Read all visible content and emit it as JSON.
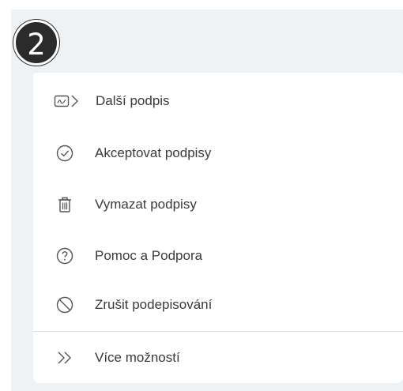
{
  "badge": {
    "number": "2"
  },
  "menu": {
    "items": [
      {
        "label": "Další podpis",
        "icon": "next-signature-icon"
      },
      {
        "label": "Akceptovat podpisy",
        "icon": "check-circle-icon"
      },
      {
        "label": "Vymazat podpisy",
        "icon": "trash-icon"
      },
      {
        "label": "Pomoc a Podpora",
        "icon": "help-circle-icon"
      },
      {
        "label": "Zrušit podepisování",
        "icon": "cancel-icon"
      }
    ],
    "more": {
      "label": "Více možností",
      "icon": "double-chevron-right-icon"
    }
  },
  "colors": {
    "background": "#eff2f5",
    "panel": "#ffffff",
    "text": "#3a3a3a",
    "icon": "#555555",
    "badge": "#2b2b2b"
  }
}
